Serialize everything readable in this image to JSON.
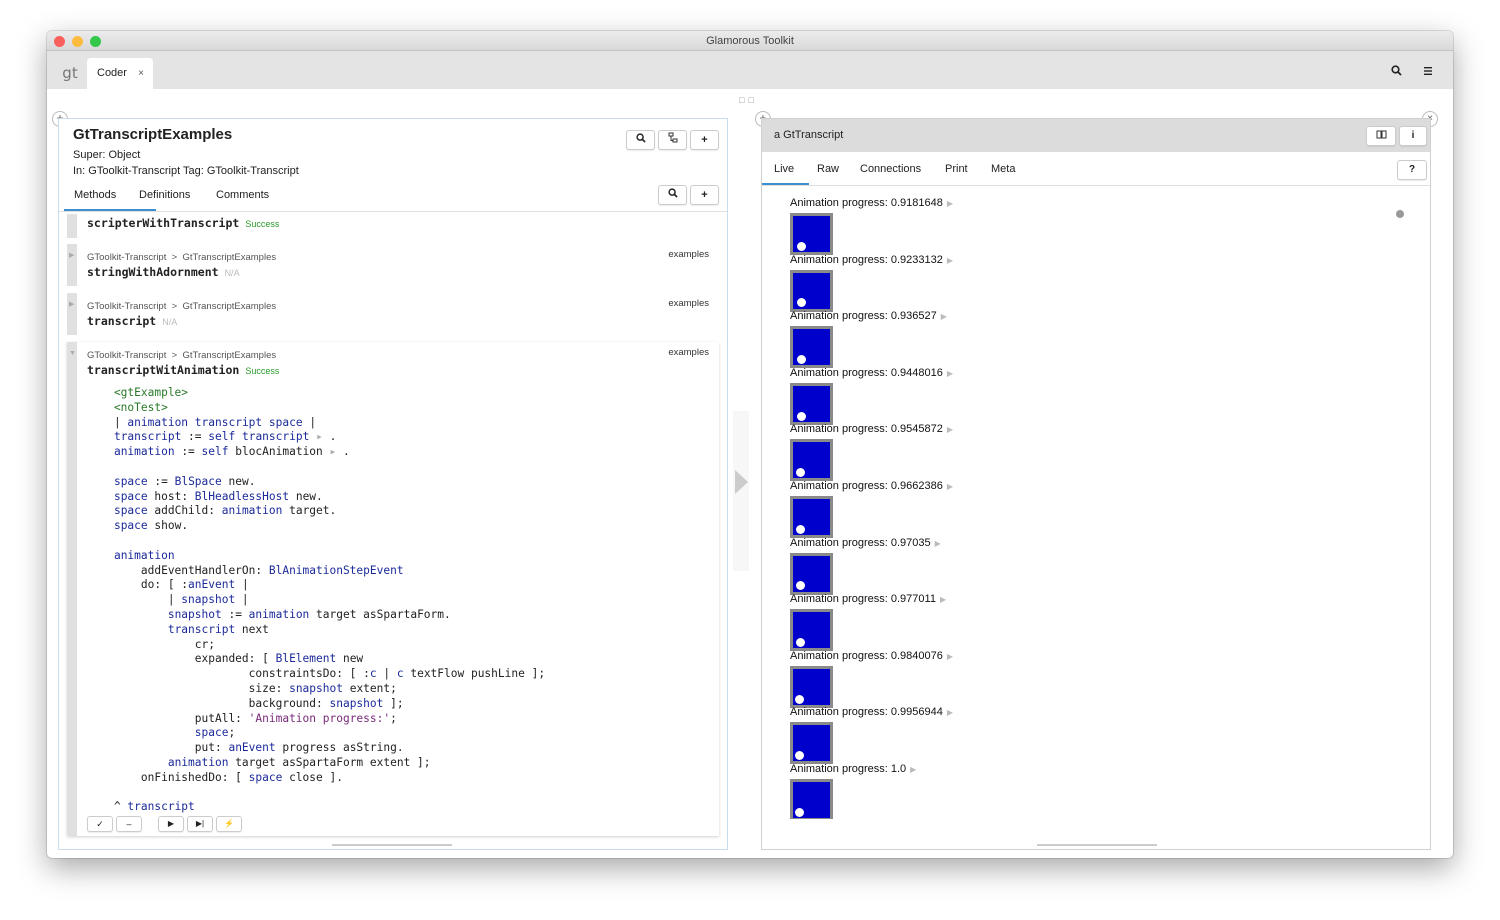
{
  "window": {
    "title": "Glamorous Toolkit"
  },
  "tabbar": {
    "logo": "gt",
    "tab_label": "Coder",
    "tab_close": "×",
    "search_icon": "search-icon",
    "menu_icon": "menu-icon"
  },
  "left": {
    "class_name": "GtTranscriptExamples",
    "super": "Super: Object",
    "package_tag": "In: GToolkit-Transcript  Tag: GToolkit-Transcript",
    "tabs": [
      "Methods",
      "Definitions",
      "Comments"
    ],
    "methods": [
      {
        "name": "scripterWithTranscript",
        "status": "Success"
      },
      {
        "crumb_pkg": "GToolkit-Transcript",
        "crumb_sep": ">",
        "crumb_cls": "GtTranscriptExamples",
        "category": "examples",
        "name": "stringWithAdornment",
        "status": "N/A"
      },
      {
        "crumb_pkg": "GToolkit-Transcript",
        "crumb_sep": ">",
        "crumb_cls": "GtTranscriptExamples",
        "category": "examples",
        "name": "transcript",
        "status": "N/A"
      },
      {
        "crumb_pkg": "GToolkit-Transcript",
        "crumb_sep": ">",
        "crumb_cls": "GtTranscriptExamples",
        "category": "examples",
        "name": "transcriptWitAnimation",
        "status": "Success"
      }
    ],
    "code_lines": [
      "    <gtExample>",
      "    <noTest>",
      "    | animation transcript space |",
      "    transcript := self transcript ▸ .",
      "    animation := self blocAnimation ▸ .",
      "",
      "    space := BlSpace new.",
      "    space host: BlHeadlessHost new.",
      "    space addChild: animation target.",
      "    space show.",
      "",
      "    animation",
      "        addEventHandlerOn: BlAnimationStepEvent",
      "        do: [ :anEvent |",
      "            | snapshot |",
      "            snapshot := animation target asSpartaForm.",
      "            transcript next",
      "                cr;",
      "                expanded: [ BlElement new",
      "                        constraintsDo: [ :c | c textFlow pushLine ];",
      "                        size: snapshot extent;",
      "                        background: snapshot ];",
      "                putAll: 'Animation progress:';",
      "                space;",
      "                put: anEvent progress asString.",
      "            animation target asSpartaForm extent ];",
      "        onFinishedDo: [ space close ].",
      "",
      "    ^ transcript"
    ],
    "action_buttons": [
      "✓",
      "–",
      "▶",
      "▶|",
      "⚡"
    ]
  },
  "right": {
    "title": "a GtTranscript",
    "tabs": [
      "Live",
      "Raw",
      "Connections",
      "Print",
      "Meta"
    ],
    "help": "?",
    "entries": [
      {
        "label": "Animation progress: 0.9181648",
        "progress": 0.9181648
      },
      {
        "label": "Animation progress: 0.9233132",
        "progress": 0.9233132
      },
      {
        "label": "Animation progress: 0.936527",
        "progress": 0.936527
      },
      {
        "label": "Animation progress: 0.9448016",
        "progress": 0.9448016
      },
      {
        "label": "Animation progress: 0.9545872",
        "progress": 0.9545872
      },
      {
        "label": "Animation progress: 0.9662386",
        "progress": 0.9662386
      },
      {
        "label": "Animation progress: 0.97035",
        "progress": 0.97035
      },
      {
        "label": "Animation progress: 0.977011",
        "progress": 0.977011
      },
      {
        "label": "Animation progress: 0.9840076",
        "progress": 0.9840076
      },
      {
        "label": "Animation progress: 0.9956944",
        "progress": 0.9956944
      },
      {
        "label": "Animation progress: 1.0",
        "progress": 1.0
      }
    ],
    "colors": {
      "snapshot_fill": "#0000cc",
      "snapshot_frame": "#8a8a8a"
    }
  }
}
